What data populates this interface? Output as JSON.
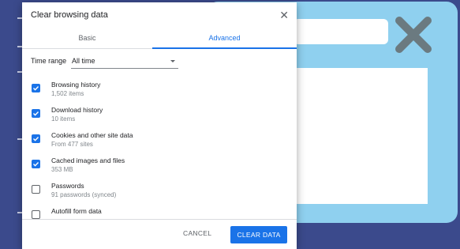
{
  "dialog": {
    "title": "Clear browsing data",
    "close_icon": "close-icon",
    "tabs": [
      {
        "label": "Basic",
        "active": false
      },
      {
        "label": "Advanced",
        "active": true
      }
    ],
    "time_range": {
      "label": "Time range",
      "value": "All time"
    },
    "items": [
      {
        "label": "Browsing history",
        "detail": "1,502 items",
        "checked": true
      },
      {
        "label": "Download history",
        "detail": "10 items",
        "checked": true
      },
      {
        "label": "Cookies and other site data",
        "detail": "From 477 sites",
        "checked": true
      },
      {
        "label": "Cached images and files",
        "detail": "353 MB",
        "checked": true
      },
      {
        "label": "Passwords",
        "detail": "91 passwords (synced)",
        "checked": false
      },
      {
        "label": "Autofill form data",
        "detail": "",
        "checked": false
      }
    ],
    "cancel_label": "CANCEL",
    "clear_label": "CLEAR DATA"
  },
  "colors": {
    "accent": "#1a73e8",
    "page_background": "#3b4a8c",
    "illustration": "#8fd0ef"
  }
}
